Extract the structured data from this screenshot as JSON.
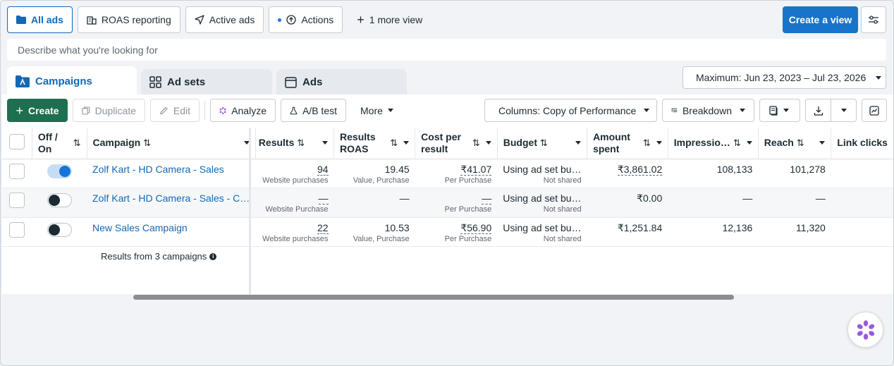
{
  "views": {
    "all_ads": "All ads",
    "roas": "ROAS reporting",
    "active_ads": "Active ads",
    "actions": "Actions",
    "more": "1 more view",
    "create_view": "Create a view"
  },
  "search": {
    "placeholder": "Describe what you're looking for"
  },
  "tabs": {
    "campaigns": "Campaigns",
    "ad_sets": "Ad sets",
    "ads": "Ads"
  },
  "date_range": "Maximum: Jun 23, 2023 – Jul 23, 2026",
  "toolbar": {
    "create": "Create",
    "duplicate": "Duplicate",
    "edit": "Edit",
    "analyze": "Analyze",
    "ab_test": "A/B test",
    "more": "More",
    "columns": "Columns: Copy of Performance",
    "breakdown": "Breakdown"
  },
  "columns": {
    "off_on": "Off / On",
    "campaign": "Campaign",
    "results": "Results",
    "results_roas": "Results ROAS",
    "cost_per_result": "Cost per result",
    "budget": "Budget",
    "amount_spent": "Amount spent",
    "impressions": "Impressio…",
    "reach": "Reach",
    "link_clicks": "Link clicks"
  },
  "rows": [
    {
      "on": true,
      "campaign": "Zolf Kart - HD Camera - Sales",
      "results": "94",
      "results_sub": "Website purchases",
      "roas": "19.45",
      "roas_sub": "Value, Purchase",
      "cpr": "₹41.07",
      "cpr_sub": "Per Purchase",
      "budget": "Using ad set bu…",
      "budget_sub": "Not shared",
      "spent": "₹3,861.02",
      "impressions": "108,133",
      "reach": "101,278"
    },
    {
      "on": false,
      "campaign": "Zolf Kart - HD Camera - Sales - C…",
      "results": "—",
      "results_sub": "Website Purchase",
      "roas": "—",
      "roas_sub": "",
      "cpr": "—",
      "cpr_sub": "Per Purchase",
      "budget": "Using ad set bu…",
      "budget_sub": "Not shared",
      "spent": "₹0.00",
      "impressions": "—",
      "reach": "—"
    },
    {
      "on": false,
      "campaign": "New Sales Campaign",
      "results": "22",
      "results_sub": "Website purchases",
      "roas": "10.53",
      "roas_sub": "Value, Purchase",
      "cpr": "₹56.90",
      "cpr_sub": "Per Purchase",
      "budget": "Using ad set bu…",
      "budget_sub": "Not shared",
      "spent": "₹1,251.84",
      "impressions": "12,136",
      "reach": "11,320"
    }
  ],
  "footer": "Results from 3 campaigns",
  "colors": {
    "accent": "#1874c8",
    "create_green": "#1e6f4f",
    "link": "#1169b5"
  }
}
